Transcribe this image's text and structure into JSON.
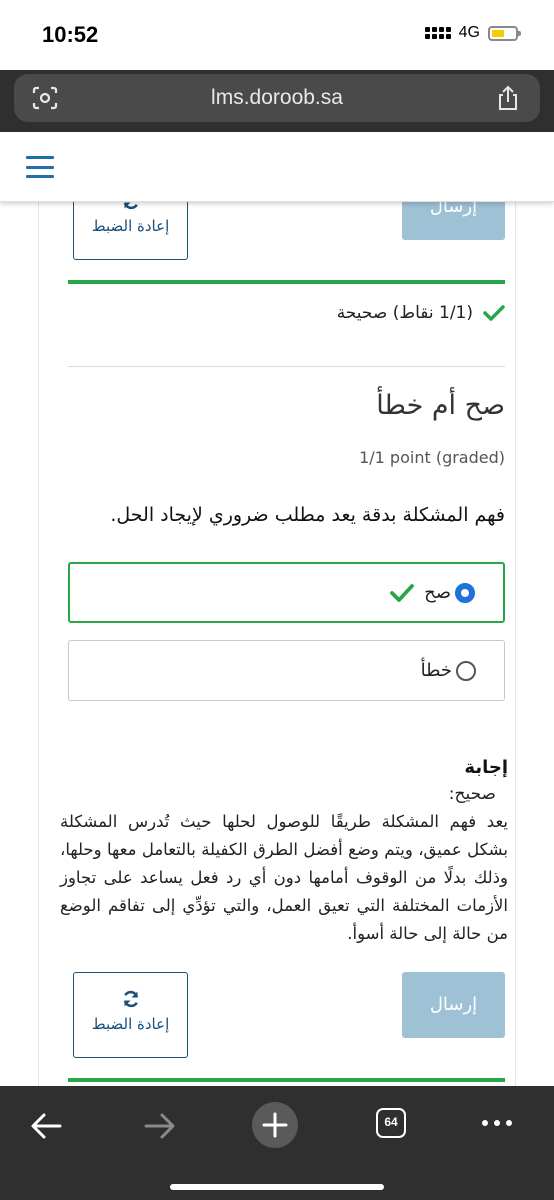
{
  "status_bar": {
    "time": "10:52",
    "network": "4G"
  },
  "browser": {
    "url": "lms.doroob.sa",
    "tabs_count": "64"
  },
  "problem": {
    "reset_label": "إعادة الضبط",
    "submit_label": "إرسال",
    "result": "(1/1 نقاط) صحيحة",
    "title": "صح أم خطأ",
    "points": "1/1 point (graded)",
    "question": "فهم المشكلة بدقة يعد مطلب ضروري لإيجاد الحل.",
    "options": [
      {
        "label": "صح",
        "selected": true,
        "correct": true
      },
      {
        "label": "خطأ",
        "selected": false,
        "correct": false
      }
    ],
    "answer_heading": "إجابة",
    "answer_label": "صحيح:",
    "answer_text": "يعد فهم المشكلة طريقًا للوصول لحلها حيث تُدرس المشكلة بشكل عميق، ويتم وضع أفضل الطرق الكفيلة بالتعامل معها وحلها، وذلك بدلًا من الوقوف أمامها دون أي رد فعل يساعد على تجاوز الأزمات المختلفة التي تعيق العمل، والتي تؤدِّي إلى تفاقم الوضع من حالة إلى حالة أسوأ."
  },
  "colors": {
    "accent_green": "#2aa64a",
    "brand_blue": "#1a5276",
    "submit_disabled": "#9ec1d6",
    "radio_blue": "#1e73d8"
  },
  "icons": [
    "lens-icon",
    "share-icon",
    "hamburger-icon",
    "refresh-icon",
    "check-icon",
    "back-icon",
    "forward-icon",
    "plus-icon",
    "tabs-icon",
    "more-icon"
  ]
}
